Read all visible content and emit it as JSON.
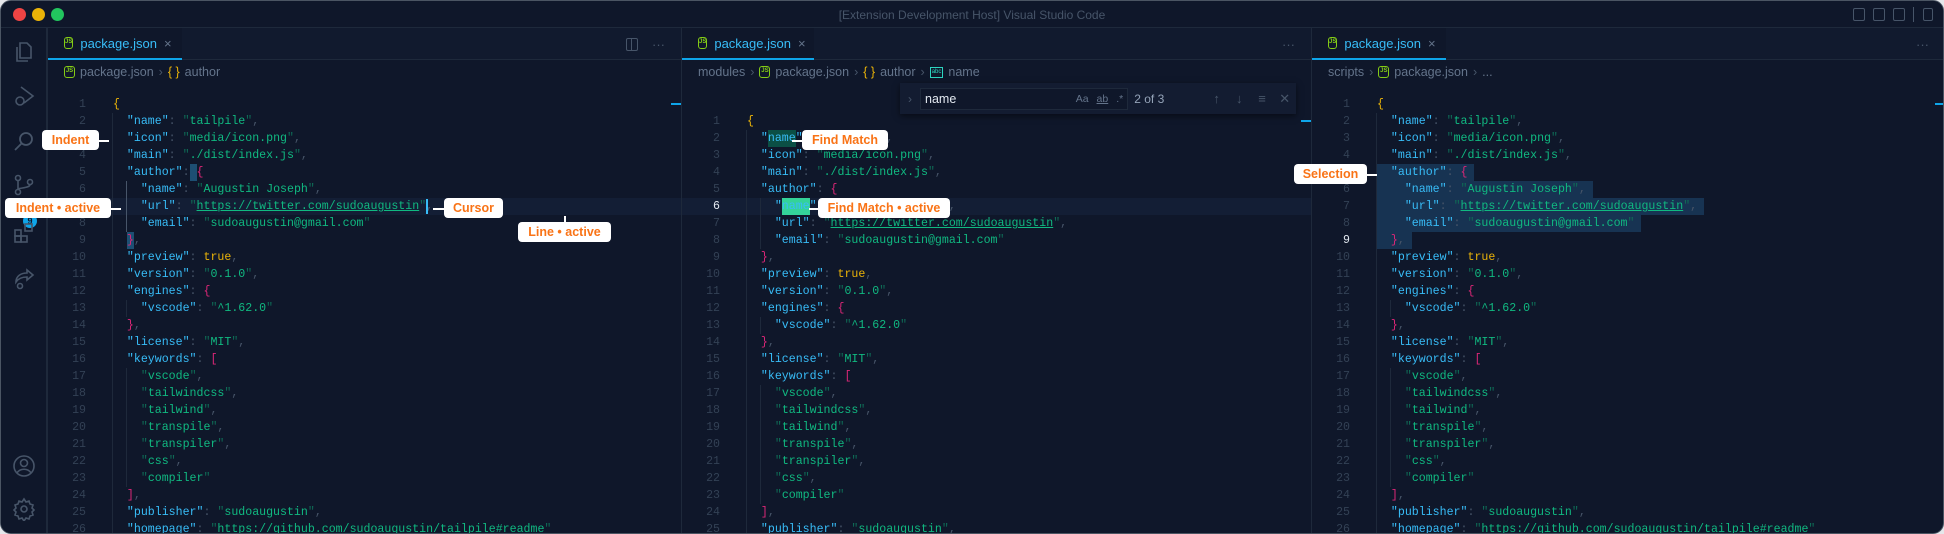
{
  "window": {
    "title": "[Extension Development Host] Visual Studio Code"
  },
  "activity_bar": {
    "items": [
      {
        "name": "explorer",
        "icon": "files-icon"
      },
      {
        "name": "run-debug",
        "icon": "debug-icon"
      },
      {
        "name": "search",
        "icon": "search-icon"
      },
      {
        "name": "source-control",
        "icon": "source-control-icon",
        "badge": "9"
      },
      {
        "name": "extensions",
        "icon": "extensions-icon"
      },
      {
        "name": "remote",
        "icon": "share-icon"
      }
    ],
    "bottom": [
      {
        "name": "accounts",
        "icon": "account-icon"
      },
      {
        "name": "manage",
        "icon": "gear-icon"
      }
    ]
  },
  "colors": {
    "accent": "#0ea5e9",
    "key": "#38bdf8",
    "string": "#10b981",
    "callout_text": "#f97316",
    "background": "#0f172a"
  },
  "panes": [
    {
      "tab": "package.json",
      "close": "×",
      "breadcrumbs": [
        "package.json",
        "author"
      ],
      "actions": "···"
    },
    {
      "tab": "package.json",
      "close": "×",
      "breadcrumbs": [
        "modules",
        "package.json",
        "author",
        "name"
      ],
      "actions": "···"
    },
    {
      "tab": "package.json",
      "close": "×",
      "breadcrumbs": [
        "scripts",
        "package.json",
        "..."
      ],
      "actions": "···"
    }
  ],
  "find": {
    "query": "name",
    "match_case": "Aa",
    "whole_word": "ab",
    "regex": ".*",
    "count": "2 of 3"
  },
  "code": [
    "{",
    "  \"name\": \"tailpile\",",
    "  \"icon\": \"media/icon.png\",",
    "  \"main\": \"./dist/index.js\",",
    "  \"author\": {",
    "    \"name\": \"Augustin Joseph\",",
    "    \"url\": \"https://twitter.com/sudoaugustin\",",
    "    \"email\": \"sudoaugustin@gmail.com\"",
    "  },",
    "  \"preview\": true,",
    "  \"version\": \"0.1.0\",",
    "  \"engines\": {",
    "    \"vscode\": \"^1.62.0\"",
    "  },",
    "  \"license\": \"MIT\",",
    "  \"keywords\": [",
    "    \"vscode\",",
    "    \"tailwindcss\",",
    "    \"tailwind\",",
    "    \"transpile\",",
    "    \"transpiler\",",
    "    \"css\",",
    "    \"compiler\"",
    "  ],",
    "  \"publisher\": \"sudoaugustin\",",
    "  \"homepage\": \"https://github.com/sudoaugustin/tailpile#readme\""
  ],
  "callouts": {
    "indent": "Indent",
    "indent_active": "Indent • active",
    "cursor": "Cursor",
    "line_active": "Line • active",
    "find_match": "Find Match",
    "find_match_active": "Find Match • active",
    "selection": "Selection"
  }
}
